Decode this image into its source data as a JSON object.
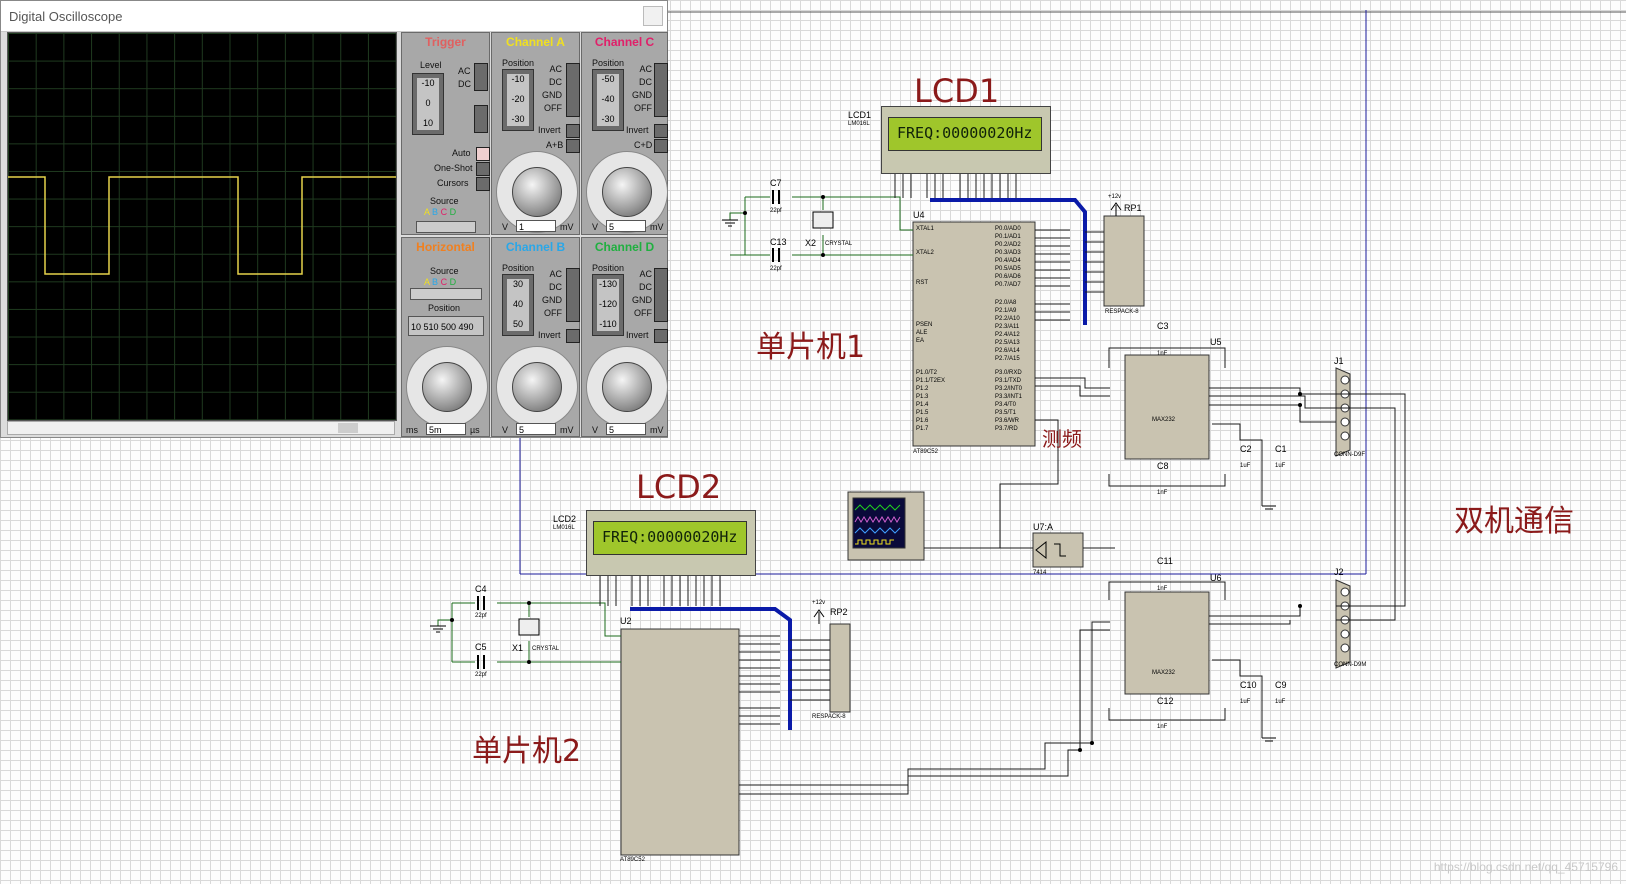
{
  "oscilloscope": {
    "window_title": "Digital Oscilloscope",
    "trigger": {
      "title": "Trigger",
      "level_label": "Level",
      "ac": "AC",
      "dc": "DC",
      "scale": [
        "-10",
        "0",
        "10"
      ],
      "auto": "Auto",
      "one_shot": "One-Shot",
      "cursors": "Cursors",
      "source_label": "Source",
      "source_letters": [
        "A",
        "B",
        "C",
        "D"
      ]
    },
    "channel_a": {
      "title": "Channel A",
      "position_label": "Position",
      "scale": [
        "-10",
        "-20",
        "-30"
      ],
      "modes": [
        "AC",
        "DC",
        "GND",
        "OFF"
      ],
      "invert": "Invert",
      "combine": "A+B",
      "dial_unit_left": "V",
      "dial_value": "1",
      "dial_unit_right": "mV",
      "color": "#f0e020"
    },
    "channel_b": {
      "title": "Channel B",
      "position_label": "Position",
      "scale": [
        "30",
        "40",
        "50"
      ],
      "modes": [
        "AC",
        "DC",
        "GND",
        "OFF"
      ],
      "invert": "Invert",
      "dial_unit_left": "V",
      "dial_value": "5",
      "dial_unit_right": "mV",
      "color": "#2aa7e8"
    },
    "channel_c": {
      "title": "Channel C",
      "position_label": "Position",
      "scale": [
        "-50",
        "-40",
        "-30"
      ],
      "modes": [
        "AC",
        "DC",
        "GND",
        "OFF"
      ],
      "invert": "Invert",
      "combine": "C+D",
      "dial_unit_left": "V",
      "dial_value": "5",
      "dial_unit_right": "mV",
      "color": "#e0206a"
    },
    "channel_d": {
      "title": "Channel D",
      "position_label": "Position",
      "scale": [
        "-130",
        "-120",
        "-110"
      ],
      "modes": [
        "AC",
        "DC",
        "GND",
        "OFF"
      ],
      "invert": "Invert",
      "dial_unit_left": "V",
      "dial_value": "5",
      "dial_unit_right": "mV",
      "color": "#20b040"
    },
    "horizontal": {
      "title": "Horizontal",
      "source_label": "Source",
      "source_letters": [
        "A",
        "B",
        "C",
        "D"
      ],
      "position_label": "Position",
      "position_readout": "10 510  500  490",
      "dial_unit_left": "ms",
      "dial_value": "5m",
      "dial_unit_right": "µs",
      "color": "#f08020"
    },
    "trace_color": "#e6d24a"
  },
  "schematic": {
    "title_lcd1": "LCD1",
    "title_lcd2": "LCD2",
    "label_mcu1": "单片机1",
    "label_mcu2": "单片机2",
    "label_comm": "双机通信",
    "label_freq": "测频",
    "lcd1": {
      "ref": "LCD1",
      "model": "LM016L",
      "text": "FREQ:00000020Hz"
    },
    "lcd2": {
      "ref": "LCD2",
      "model": "LM016L",
      "text": "FREQ:00000020Hz"
    },
    "u4": {
      "ref": "U4",
      "model": "AT89C52",
      "left_pins": [
        "XTAL1",
        "XTAL2",
        "RST",
        "PSEN",
        "ALE",
        "EA",
        "P1.0/T2",
        "P1.1/T2EX",
        "P1.2",
        "P1.3",
        "P1.4",
        "P1.5",
        "P1.6",
        "P1.7"
      ],
      "right_pins": [
        "P0.0/AD0",
        "P0.1/AD1",
        "P0.2/AD2",
        "P0.3/AD3",
        "P0.4/AD4",
        "P0.5/AD5",
        "P0.6/AD6",
        "P0.7/AD7",
        "P2.0/A8",
        "P2.1/A9",
        "P2.2/A10",
        "P2.3/A11",
        "P2.4/A12",
        "P2.5/A13",
        "P2.6/A14",
        "P2.7/A15",
        "P3.0/RXD",
        "P3.1/TXD",
        "P3.2/INT0",
        "P3.3/INT1",
        "P3.4/T0",
        "P3.5/T1",
        "P3.6/WR",
        "P3.7/RD"
      ]
    },
    "u2": {
      "ref": "U2",
      "model": "AT89C52"
    },
    "u5": {
      "ref": "U5",
      "model": "MAX232"
    },
    "u6": {
      "ref": "U6",
      "model": "MAX232"
    },
    "u7": {
      "ref": "U7:A",
      "model": "7414"
    },
    "rp1": {
      "ref": "RP1",
      "model": "RESPACK-8",
      "supply": "+12v"
    },
    "rp2": {
      "ref": "RP2",
      "model": "RESPACK-8",
      "supply": "+12v"
    },
    "j1": {
      "ref": "J1",
      "model": "CONN-D9F"
    },
    "j2": {
      "ref": "J2",
      "model": "CONN-D9M"
    },
    "x1": {
      "ref": "X1",
      "model": "CRYSTAL"
    },
    "x2": {
      "ref": "X2",
      "model": "CRYSTAL"
    },
    "caps": {
      "c7": "C7",
      "c13": "C13",
      "c4": "C4",
      "c5": "C5",
      "c3": "C3",
      "c8": "C8",
      "c2": "C2",
      "c1": "C1",
      "c11": "C11",
      "c12": "C12",
      "c10": "C10",
      "c9": "C9",
      "val_22pf": "22pf",
      "val_1nf": "1nF",
      "val_1uf": "1uF"
    },
    "watermark": "https://blog.csdn.net/qq_45715796"
  }
}
